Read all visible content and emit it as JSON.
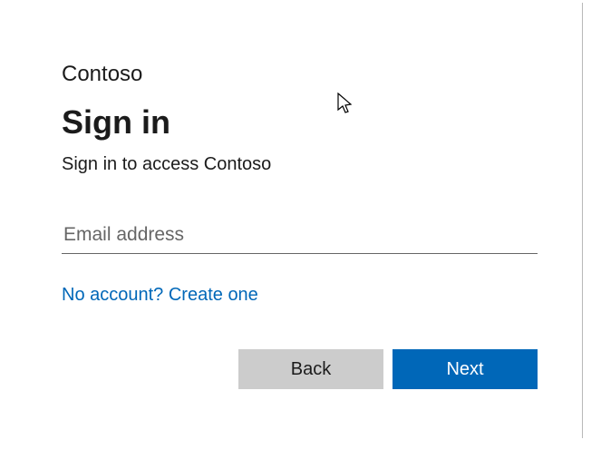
{
  "company": "Contoso",
  "title": "Sign in",
  "instruction": "Sign in to access Contoso",
  "email": {
    "placeholder": "Email address",
    "value": ""
  },
  "createAccountLink": "No account? Create one",
  "buttons": {
    "back": "Back",
    "next": "Next"
  },
  "colors": {
    "primary": "#0067b8",
    "secondary": "#cccccc"
  }
}
